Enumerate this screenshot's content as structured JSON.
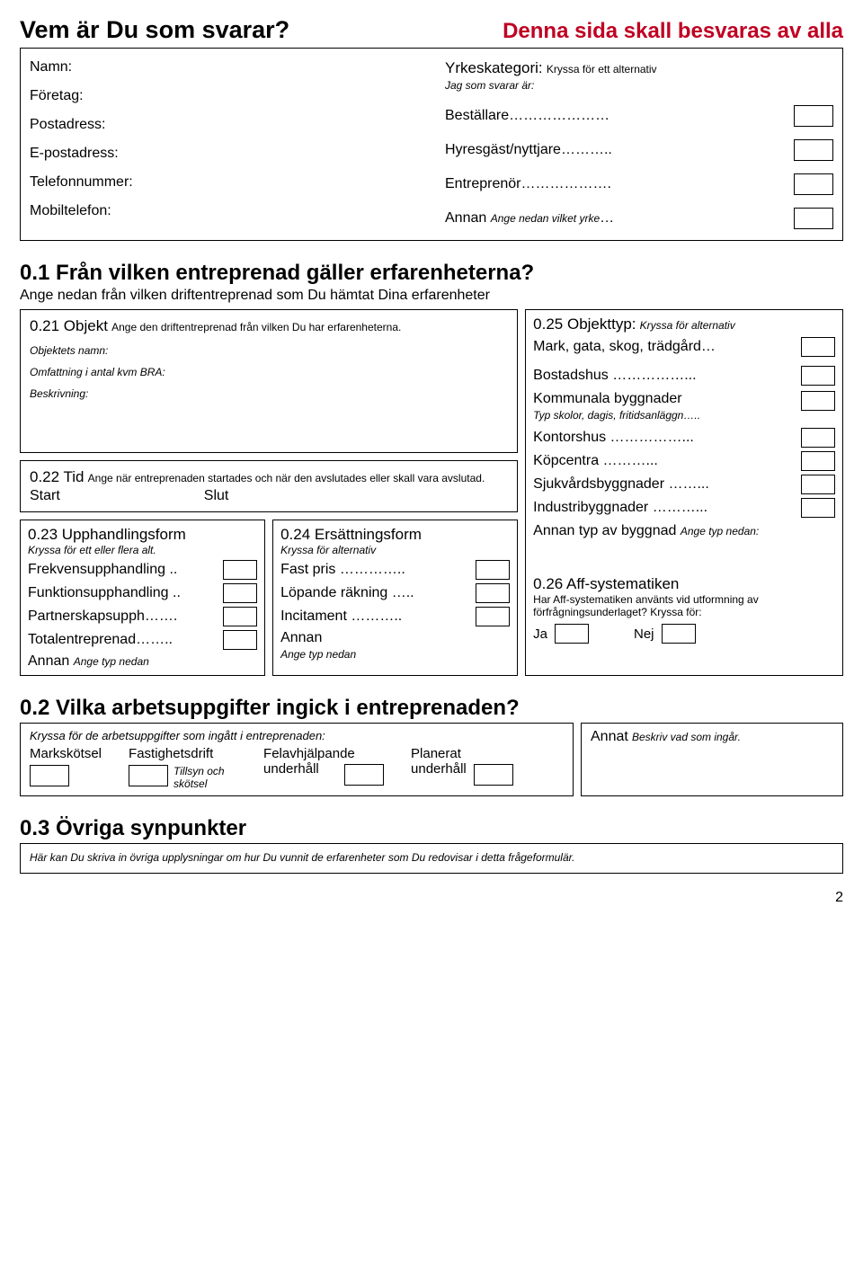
{
  "header": {
    "left": "Vem är Du som svarar?",
    "right": "Denna sida skall besvaras av alla"
  },
  "respondent": {
    "namn": "Namn:",
    "foretag": "Företag:",
    "postadress": "Postadress:",
    "epost": "E-postadress:",
    "tel": "Telefonnummer:",
    "mobil": "Mobiltelefon:"
  },
  "yrkes": {
    "title": "Yrkeskategori:",
    "title_hint": "Kryssa för ett alternativ",
    "sub": "Jag som svarar är:",
    "opts": [
      "Beställare…………………",
      "Hyresgäst/nyttjare………..",
      "Entreprenör……………….",
      "Annan Ange nedan vilket yrke…"
    ],
    "annan_hint": "Ange nedan vilket yrke"
  },
  "s01": {
    "heading": "0.1   Från vilken entreprenad gäller erfarenheterna?",
    "sub": "Ange nedan från vilken driftentreprenad som Du hämtat Dina erfarenheter"
  },
  "b21": {
    "title": "0.21 Objekt",
    "title_hint": "Ange den driftentreprenad från vilken Du har erfarenheterna.",
    "l1": "Objektets namn:",
    "l2": "Omfattning i antal kvm BRA:",
    "l3": "Beskrivning:"
  },
  "b22": {
    "title": "0.22 Tid",
    "hint": "Ange när entreprenaden startades och när den avslutades eller skall vara avslutad.",
    "start": "Start",
    "slut": "Slut"
  },
  "b23": {
    "title": "0.23 Upphandlingsform",
    "hint": "Kryssa för ett eller flera alt.",
    "opts": [
      "Frekvensupphandling ..",
      "Funktionsupphandling ..",
      "Partnerskapsupph…….",
      "Totalentreprenad……..",
      "Annan Ange typ nedan"
    ],
    "annan_hint": "Ange typ nedan"
  },
  "b24": {
    "title": "0.24 Ersättningsform",
    "hint": "Kryssa för alternativ",
    "opts": [
      "Fast pris …………..",
      "Löpande räkning …..",
      "Incitament ………..",
      "Annan"
    ],
    "annan_hint": "Ange typ nedan"
  },
  "b25": {
    "title": "0.25 Objekttyp:",
    "hint": "Kryssa för alternativ",
    "line1": "Mark, gata, skog, trädgård…",
    "opts": [
      "Bostadshus ……………...",
      "Kommunala byggnader",
      "Kontorshus ……………...",
      "Köpcentra ………...",
      "Sjukvårdsbyggnader ……...",
      "Industribyggnader ………...",
      "Annan typ av byggnad Ange typ nedan:"
    ],
    "komm_hint": "Typ skolor, dagis, fritidsanläggn…..",
    "annan_hint": "Ange typ nedan:"
  },
  "b26": {
    "title": "0.26 Aff-systematiken",
    "hint": "Har Aff-systematiken använts vid utformning av förfrågningsunderlaget? Kryssa för:",
    "ja": "Ja",
    "nej": "Nej"
  },
  "s02": {
    "heading": "0.2   Vilka arbetsuppgifter ingick i entreprenaden?",
    "hint": "Kryssa för de arbetsuppgifter som ingått i entreprenaden:",
    "tasks": [
      "Markskötsel",
      "Fastighetsdrift",
      "Felavhjälpande underhåll",
      "Planerat underhåll"
    ],
    "task2sub": "Tillsyn och skötsel",
    "annat": "Annat",
    "annat_hint": "Beskriv vad som ingår."
  },
  "s03": {
    "heading": "0.3   Övriga synpunkter",
    "hint": "Här kan Du skriva in övriga upplysningar om hur Du vunnit de erfarenheter som Du redovisar i detta frågeformulär."
  },
  "page": "2"
}
